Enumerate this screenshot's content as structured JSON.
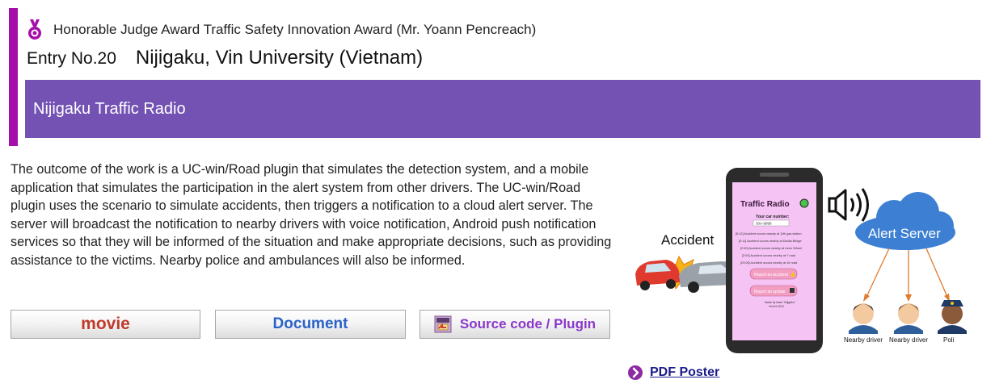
{
  "award": {
    "title": "Honorable Judge Award Traffic Safety Innovation Award (Mr. Yoann Pencreach)",
    "accent_color": "#a50ea8"
  },
  "entry": {
    "number": "Entry No.20",
    "team": "Nijigaku, Vin University (Vietnam)"
  },
  "work": {
    "title": "Nijigaku Traffic Radio",
    "band_color": "#7352b4",
    "description": "The outcome of the work is a UC-win/Road plugin that simulates the detection system, and a mobile application that simulates the participation in the alert system from other drivers. The UC-win/Road plugin uses the scenario to simulate accidents, then triggers a notification to a cloud alert server. The server will broadcast the notification to nearby drivers with voice notification, Android push notification services so that they will be informed of the situation and make appropriate decisions, such as providing assistance to the victims. Nearby police and ambulances will also be informed."
  },
  "buttons": {
    "movie": "movie",
    "document": "Document",
    "source": "Source code / Plugin"
  },
  "illustration": {
    "accident_label": "Accident",
    "server_label": "Alert Server",
    "app_title": "Traffic Radio",
    "car_number_label": "Your car number:",
    "car_number_value": "30A-9999",
    "feed": [
      "[5:12] Accident occurs nearby at 11th gas station",
      "[5:11] Accident occurs nearby at Dahila Bridge",
      "[2:50] Accident occurs nearby at Lieve Wheel",
      "[2:04] Accident occurs nearby at Y road",
      "[23:06] Accident occurs nearby at 16 road"
    ],
    "report_button": "Report an accident",
    "update_button": "Report an update",
    "footer_line1": "Made by team \"Nijigaku\"",
    "footer_line2": "VinUni 2022",
    "receivers": [
      "Nearby driver",
      "Nearby driver",
      "Poli"
    ]
  },
  "poster": {
    "link": "PDF Poster"
  },
  "colors": {
    "phone_screen": "#f6c3f5",
    "cloud": "#3c7fd3",
    "arrow": "#e07a2e",
    "movie_text": "#c0392b",
    "document_text": "#2a62c9",
    "source_text": "#8a38c9",
    "link_icon": "#8e2aa3"
  }
}
